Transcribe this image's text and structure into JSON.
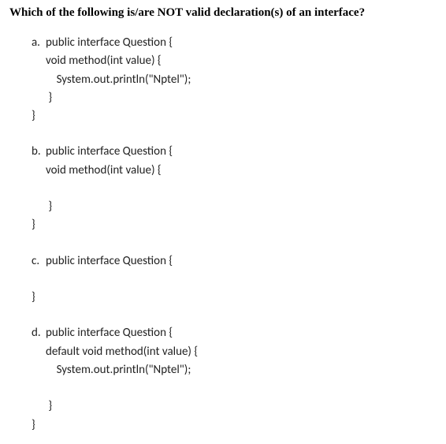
{
  "question": "Which of the following is/are NOT valid declaration(s) of an interface?",
  "options": {
    "a": {
      "letter": "a.",
      "l1": "public interface Question {",
      "l2": "void method(int value) {",
      "l3": "    System.out.println(\"Nptel\");",
      "l4": " }",
      "l5": "}"
    },
    "b": {
      "letter": "b.",
      "l1": "public interface Question {",
      "l2": "void method(int value) {",
      "l3": " ",
      "l4": " }",
      "l5": "}"
    },
    "c": {
      "letter": "c.",
      "l1": "public interface Question {",
      "l2": " ",
      "l3": "}"
    },
    "d": {
      "letter": "d.",
      "l1": "public interface Question {",
      "l2": "default void method(int value) {",
      "l3": "    System.out.println(\"Nptel\");",
      "l4": " ",
      "l5": " }",
      "l6": "}"
    }
  }
}
